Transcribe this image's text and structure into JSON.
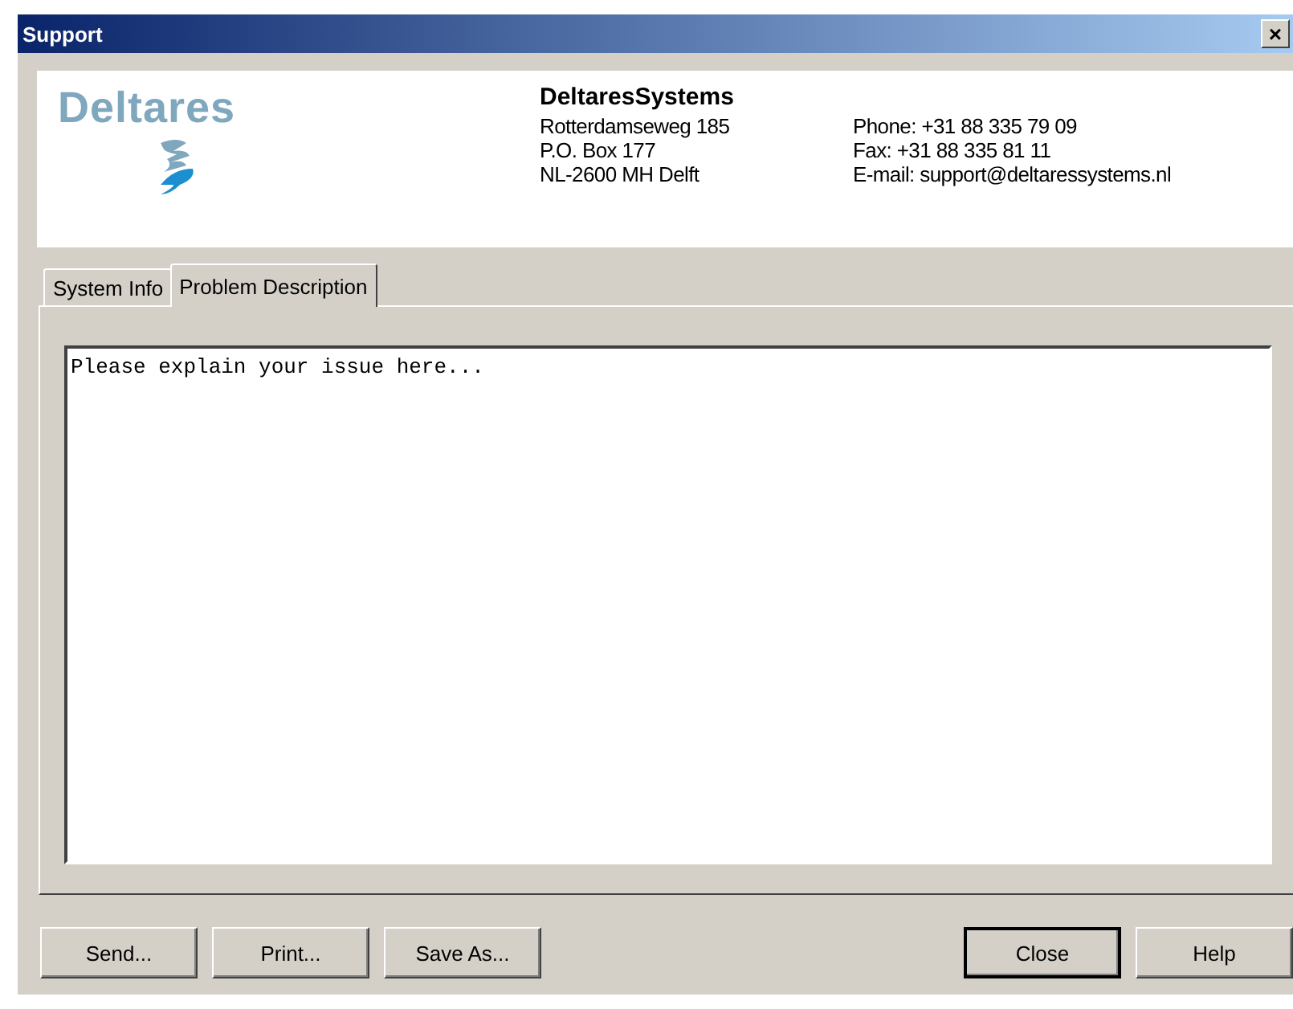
{
  "window": {
    "title": "Support",
    "close_glyph": "×"
  },
  "header": {
    "company": "DeltaresSystems",
    "logo_text": "Deltares",
    "address": [
      "Rotterdamseweg 185",
      "P.O. Box 177",
      "NL-2600 MH  Delft"
    ],
    "contact": [
      "Phone: +31 88 335 79 09",
      "Fax: +31 88 335 81 11",
      "E-mail: support@deltaressystems.nl"
    ]
  },
  "tabs": [
    {
      "label": "System Info",
      "selected": false
    },
    {
      "label": "Problem Description",
      "selected": true
    }
  ],
  "description": {
    "value": "Please explain your issue here..."
  },
  "buttons_left": [
    {
      "label": "Send...",
      "default": false
    },
    {
      "label": "Print...",
      "default": false
    },
    {
      "label": "Save As...",
      "default": false
    }
  ],
  "buttons_right": [
    {
      "label": "Close",
      "default": true
    },
    {
      "label": "Help",
      "default": false
    }
  ]
}
